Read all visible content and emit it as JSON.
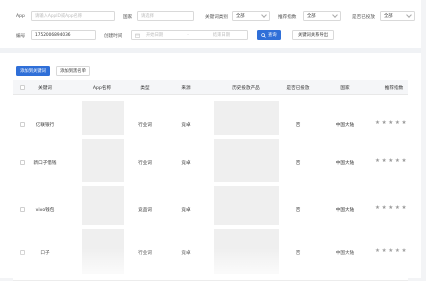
{
  "filters": {
    "app_label": "App",
    "app_placeholder": "请输入AppID或App名称",
    "country_label": "国家",
    "country_placeholder": "请选择",
    "keyword_type_label": "关键词类别",
    "keyword_type_value": "全部",
    "recommend_label": "推荐指数",
    "recommend_value": "全部",
    "delivered_label": "是否已投放",
    "delivered_value": "全部",
    "id_label": "编号",
    "id_value": "1752006894036",
    "created_label": "创建时间",
    "start_placeholder": "开始日期",
    "range_separator": "-",
    "end_placeholder": "结束日期",
    "search_label": "查询",
    "export_label": "关键词关系导出"
  },
  "actions": {
    "add_label": "添加到关键词",
    "add_to_list_label": "添加到黑名单"
  },
  "table": {
    "headers": [
      "关键词",
      "App名称",
      "类型",
      "来源",
      "历史投放产品",
      "是否已投放",
      "国家",
      "推荐指数"
    ],
    "rows": [
      {
        "keyword": "亿联银行",
        "type": "行业词",
        "source": "竞卓",
        "delivered": "否",
        "country": "中国大陆",
        "stars": "★★★★★",
        "rating": 5
      },
      {
        "keyword": "新口子借钱",
        "type": "行业词",
        "source": "竞卓",
        "delivered": "否",
        "country": "中国大陆",
        "stars": "★★★★★",
        "rating": 5
      },
      {
        "keyword": "vivo钱包",
        "type": "竞品词",
        "source": "竞卓",
        "delivered": "否",
        "country": "中国大陆",
        "stars": "★★★★★",
        "rating": 5
      },
      {
        "keyword": "口子",
        "type": "行业词",
        "source": "竞卓",
        "delivered": "否",
        "country": "中国大陆",
        "stars": "★★★★★",
        "rating": 5
      }
    ]
  },
  "colors": {
    "primary": "#2f6fd8",
    "star": "#9a9a9a"
  },
  "icons": {
    "search_button": "search-icon",
    "date_picker": "calendar-icon",
    "dropdown": "chevron-down-icon"
  }
}
